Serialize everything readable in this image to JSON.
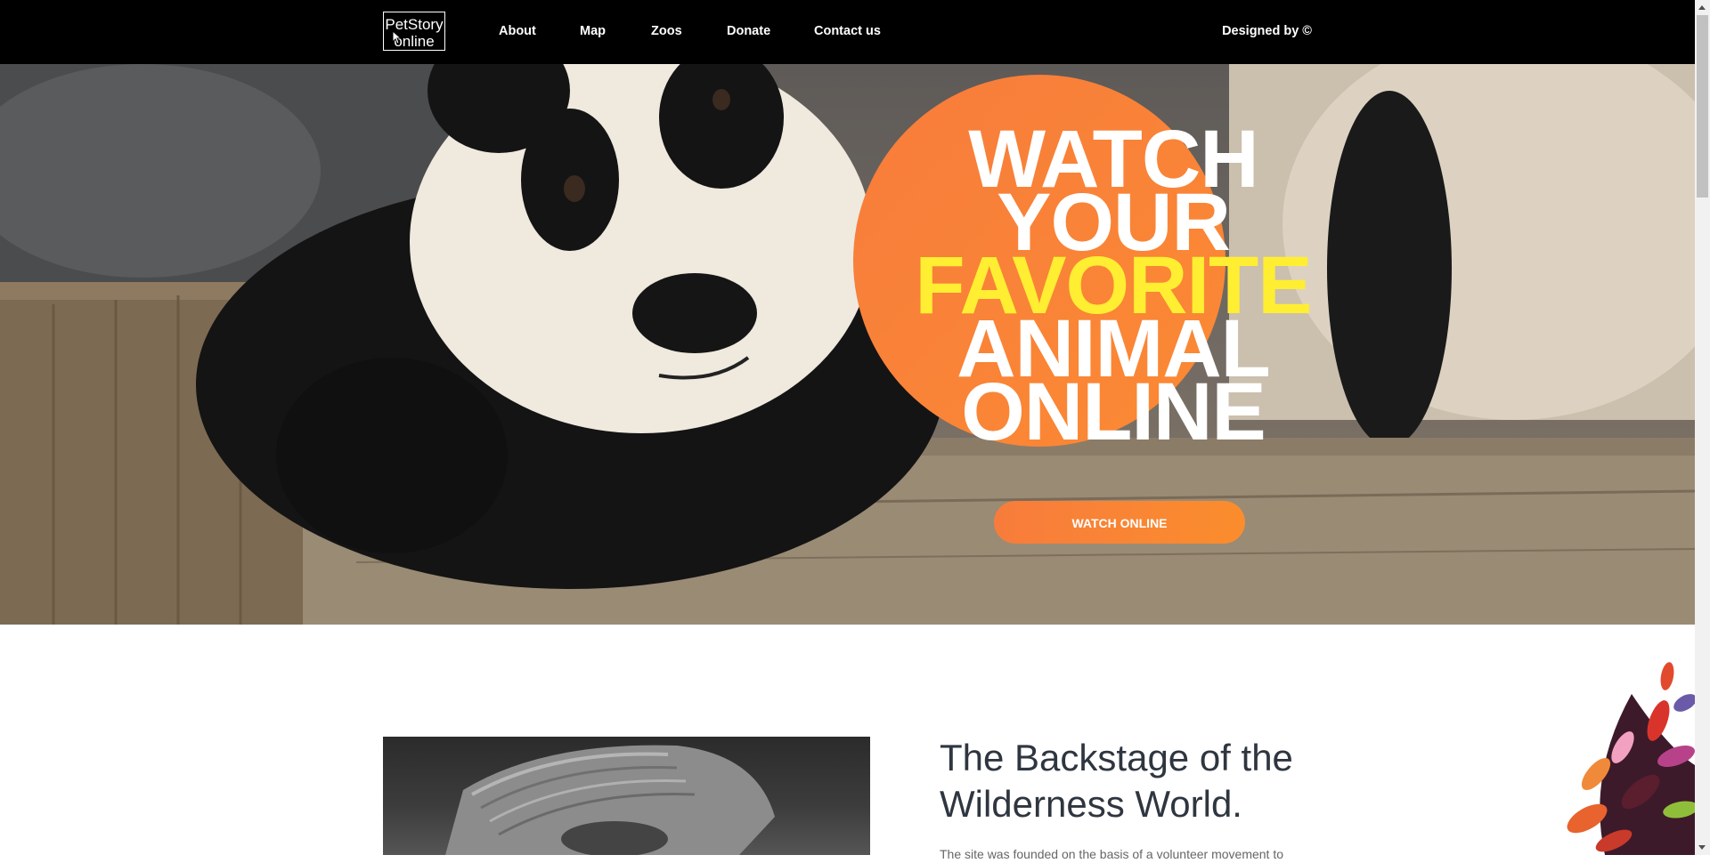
{
  "nav": {
    "logo_line1": "PetStory",
    "logo_line2": "online",
    "links": [
      "About",
      "Map",
      "Zoos",
      "Donate",
      "Contact us"
    ],
    "designed_by": "Designed by ©"
  },
  "hero": {
    "headline": [
      "WATCH",
      "YOUR",
      "FAVORITE",
      "ANIMAL",
      "ONLINE"
    ],
    "highlight_color": "#ffee32",
    "accent_color": "#f77c3c",
    "cta_label": "WATCH ONLINE"
  },
  "about": {
    "title": "The Backstage of the Wilderness World.",
    "text": "The site was founded on the basis of a volunteer movement to"
  },
  "icons": {
    "cursor": "mouse-pointer-icon",
    "scroll_up": "scroll-up-arrow-icon",
    "scroll_down": "scroll-down-arrow-icon"
  }
}
